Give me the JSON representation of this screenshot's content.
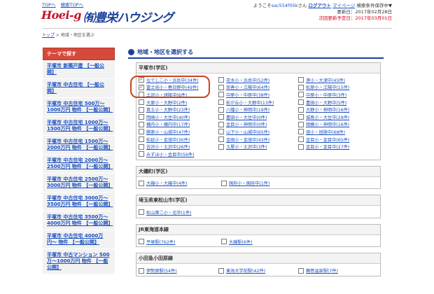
{
  "header": {
    "nav": [
      "TOPへ",
      "検索TOPへ"
    ],
    "logo_en": "Hoei-g",
    "logo_jp": "㈲豊栄ハウジング",
    "greeting_prefix": "ようこそ",
    "user_email": "sac554f05k",
    "greeting_suffix": "さん",
    "logout": "ログアウト",
    "mypage": "マイページ",
    "search_cond": "検索条件保存中▼",
    "updated": "更新日：2017年02月28日",
    "next_update": "次回更新予定日：2017年03月01日"
  },
  "breadcrumb": {
    "home": "トップ",
    "sep": " > ",
    "current": "地域・地区を選ぶ"
  },
  "sidebar": {
    "head": "テーマで探す",
    "items": [
      "平塚市 新築戸建 【一般公開】",
      "平塚市 中古住宅 【一般公開】",
      "平塚市 中古住宅 500万〜1000万円 物件 【一般公開】",
      "平塚市 中古住宅 1000万〜1500万円 物件 【一般公開】",
      "平塚市 中古住宅 1500万〜2000万円 物件 【一般公開】",
      "平塚市 中古住宅 2000万〜2500万円 物件 【一般公開】",
      "平塚市 中古住宅 2500万〜3000万円 物件 【一般公開】",
      "平塚市 中古住宅 3000万〜3500万円 物件 【一般公開】",
      "平塚市 中古住宅 3500万〜4000万円 物件 【一般公開】",
      "平塚市 中古住宅 4000万円〜 物件 【一般公開】",
      "平塚市 中古マンション 500万〜1000万円 物件 【一般公開】"
    ]
  },
  "main": {
    "title": "地域・地区を選択する",
    "sections": [
      {
        "title": "平塚市(学区)",
        "rows": [
          [
            [
              "なでしこ小・浜岳中(34件)",
              true
            ],
            [
              "花水小・浜岳中(52件)",
              false
            ],
            [
              "港小・大津中(45件)",
              false
            ]
          ],
          [
            [
              "富士見小・春日野中(49件)",
              true
            ],
            [
              "崇善小・江陽中(64件)",
              false
            ],
            [
              "松原小・江陽中(15件)",
              false
            ]
          ],
          [
            [
              "土沢小・旭陵中(6件)",
              false
            ],
            [
              "中原小・中原中(38件)",
              false
            ],
            [
              "中原小・中原中(3件)",
              false
            ]
          ],
          [
            [
              "大原小・大野中(2件)",
              false
            ],
            [
              "松が丘小・大野中(13件)",
              false
            ],
            [
              "豊田小・大野中(5件)",
              false
            ]
          ],
          [
            [
              "真土小・大野中(23件)",
              false
            ],
            [
              "八幡小・神明中(19件)",
              false
            ],
            [
              "大野小・神明中(16件)",
              false
            ]
          ],
          [
            [
              "岡崎小・大住中(40件)",
              false
            ],
            [
              "豊田小・大住中(0件)",
              false
            ],
            [
              "城島小・大住中(29件)",
              false
            ]
          ],
          [
            [
              "横内小・横内中(17件)",
              false
            ],
            [
              "金目小・神明中(0件)",
              false
            ],
            [
              "相模小・神明中(16件)",
              false
            ]
          ],
          [
            [
              "勝原小・山城中(47件)",
              false
            ],
            [
              "山下小・山城中(65件)",
              false
            ],
            [
              "旭小・旭陵中(68件)",
              false
            ]
          ],
          [
            [
              "松延小・金旭中(30件)",
              false
            ],
            [
              "金田小・金旭中(43件)",
              false
            ],
            [
              "金目小・金目中(65件)",
              false
            ]
          ],
          [
            [
              "吉沢小・土沢中(26件)",
              false
            ],
            [
              "土屋小・土沢中(3件)",
              false
            ],
            [
              "金目小・金目中(27件)",
              false
            ]
          ],
          [
            [
              "みずほ小・金目中(56件)",
              false
            ]
          ]
        ]
      },
      {
        "title": "大磯町(学区)",
        "rows": [
          [
            [
              "大磯小・大磯中(4件)",
              false
            ],
            [
              "国府小・国府中(1件)",
              false
            ]
          ]
        ]
      },
      {
        "title": "埼玉県東松山市(学区)",
        "rows": [
          [
            [
              "松山第二小・北中(1件)",
              false
            ]
          ]
        ]
      },
      {
        "title": "JR東海道本線",
        "rows": [
          [
            [
              "平塚駅(762件)",
              false
            ],
            [
              "大磯駅(6件)",
              false
            ]
          ]
        ]
      },
      {
        "title": "小田急小田原線",
        "rows": [
          [
            [
              "伊勢原駅(54件)",
              false
            ],
            [
              "東海大学前駅(42件)",
              false
            ],
            [
              "鶴巻温泉駅(7件)",
              false
            ]
          ]
        ]
      }
    ]
  },
  "colors": {
    "accent": "#1b3f9c",
    "sidebar_head": "#d54a3a",
    "highlight_ring": "#c8441e",
    "logo_red": "#c8102e"
  }
}
